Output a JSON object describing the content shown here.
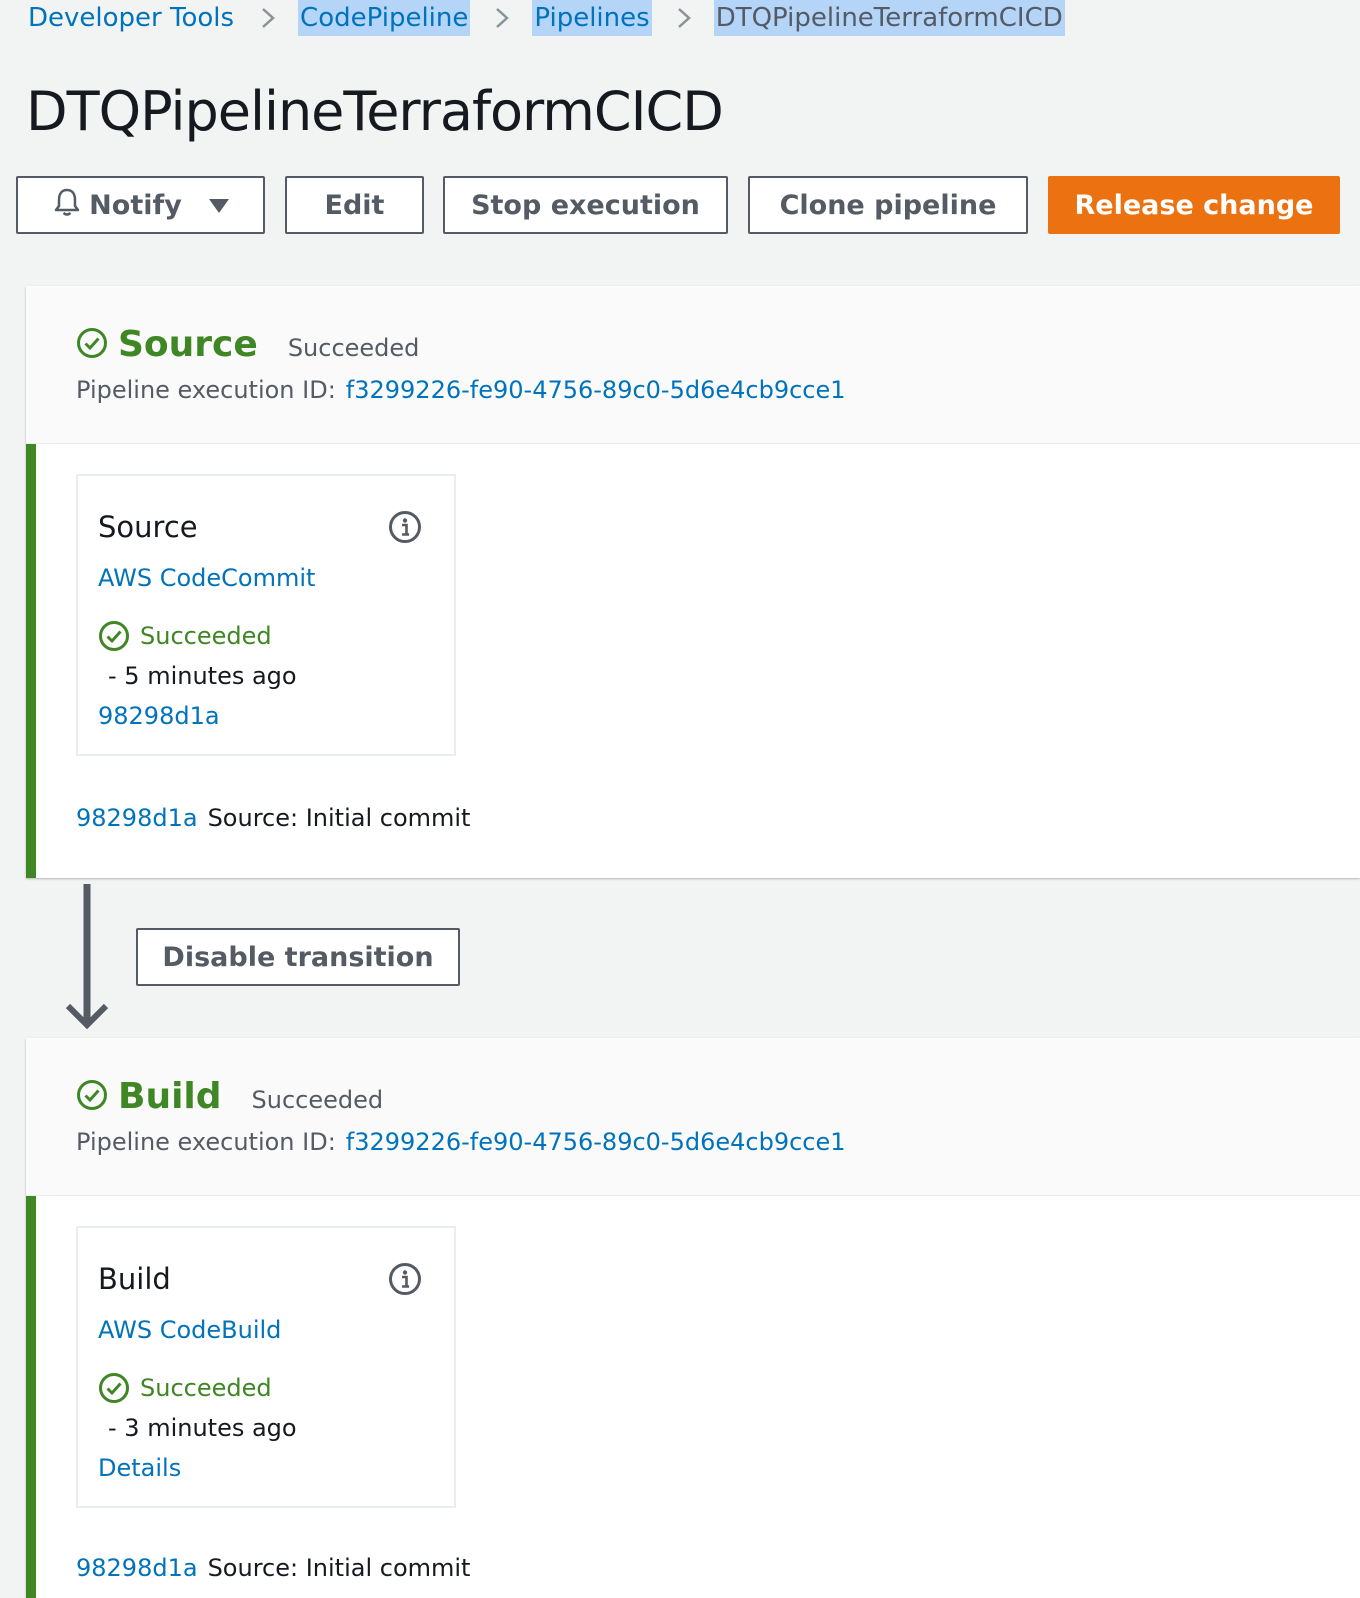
{
  "breadcrumbs": [
    "Developer Tools",
    "CodePipeline",
    "Pipelines",
    "DTQPipelineTerraformCICD"
  ],
  "page_title": "DTQPipelineTerraformCICD",
  "toolbar": {
    "notify": "Notify",
    "edit": "Edit",
    "stop": "Stop execution",
    "clone": "Clone pipeline",
    "release": "Release change"
  },
  "colors": {
    "success": "#3f8624",
    "link": "#0073bb",
    "primary": "#ec7211"
  },
  "stages": [
    {
      "name": "Source",
      "status": "Succeeded",
      "exec_label": "Pipeline execution ID:",
      "exec_id": "f3299226-fe90-4756-89c0-5d6e4cb9cce1",
      "action": {
        "title": "Source",
        "provider": "AWS CodeCommit",
        "status": "Succeeded",
        "time": "-  5 minutes ago",
        "link": "98298d1a"
      },
      "commit_id": "98298d1a",
      "commit_msg": "Source: Initial commit"
    },
    {
      "name": "Build",
      "status": "Succeeded",
      "exec_label": "Pipeline execution ID:",
      "exec_id": "f3299226-fe90-4756-89c0-5d6e4cb9cce1",
      "action": {
        "title": "Build",
        "provider": "AWS CodeBuild",
        "status": "Succeeded",
        "time": "-  3 minutes ago",
        "link": "Details"
      },
      "commit_id": "98298d1a",
      "commit_msg": "Source: Initial commit"
    }
  ],
  "transition": {
    "button": "Disable transition"
  }
}
